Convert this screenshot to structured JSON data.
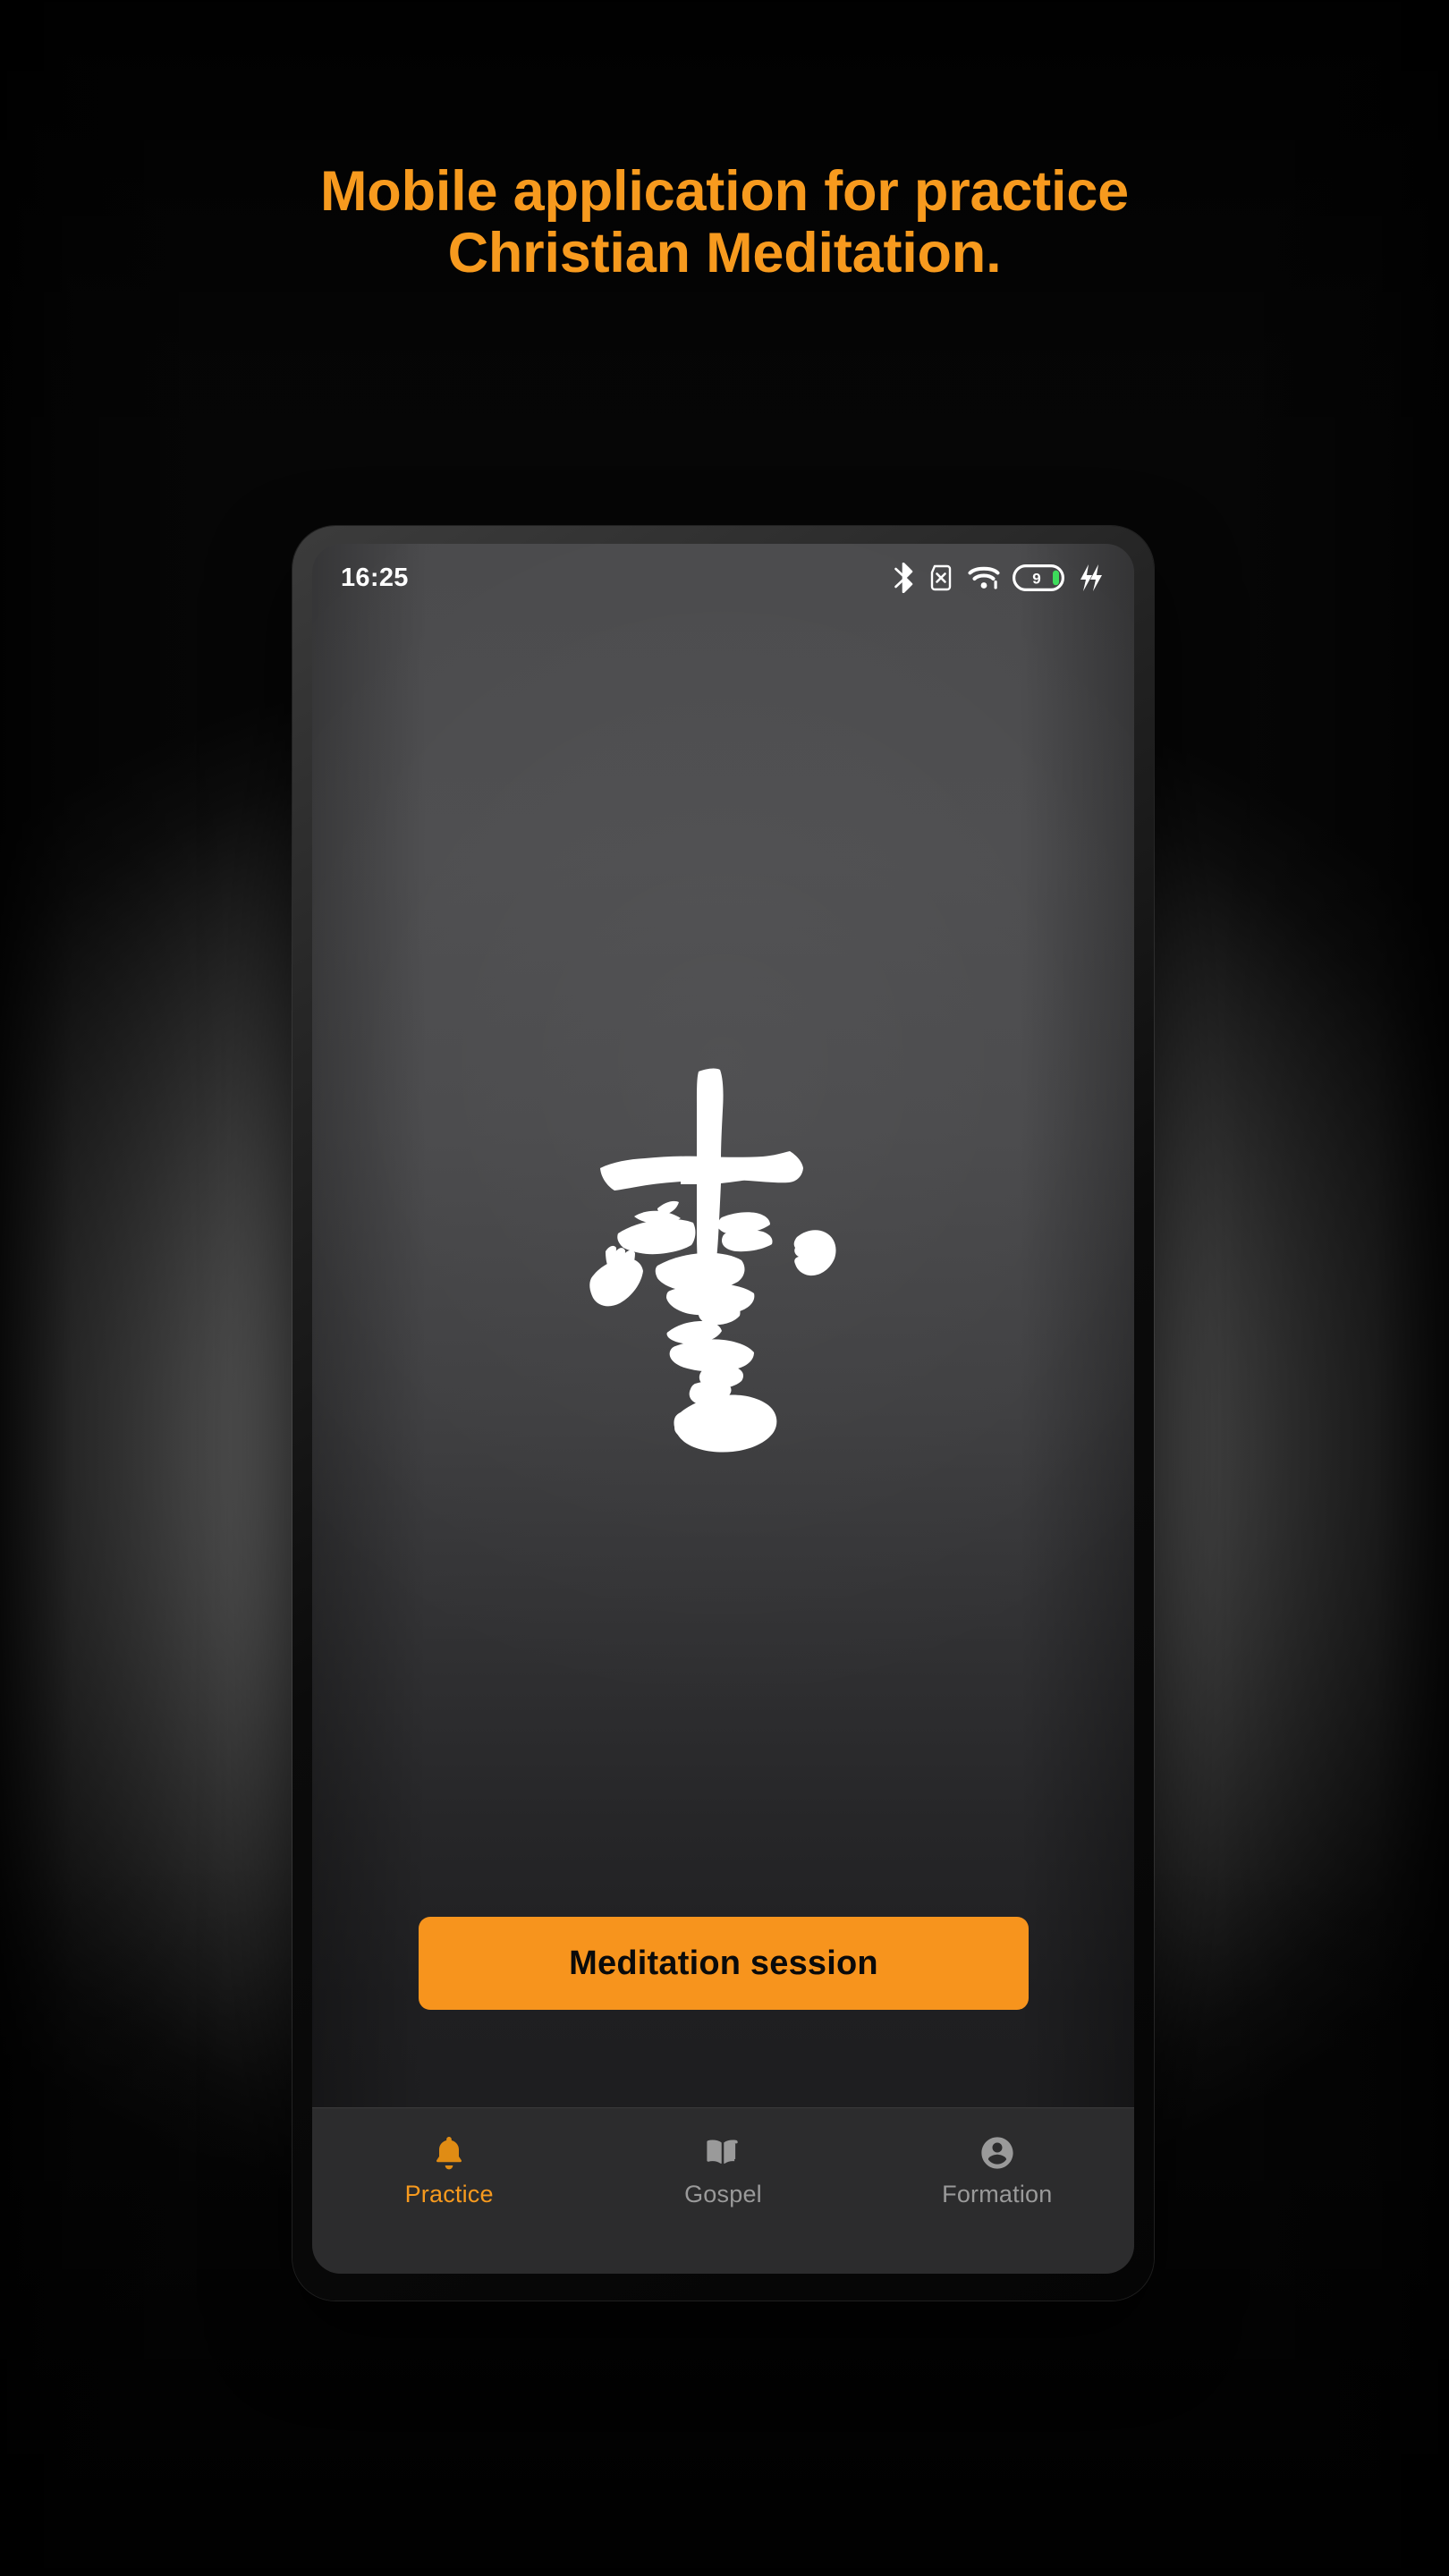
{
  "headline": {
    "text": "Mobile application for practice\nChristian Meditation.",
    "color": "#F79A1E"
  },
  "phone": {
    "statusbar": {
      "time": "16:25",
      "icons": [
        {
          "name": "bluetooth-icon",
          "label": "Bluetooth"
        },
        {
          "name": "sim-card-off-icon",
          "label": "No SIM"
        },
        {
          "name": "wifi-icon",
          "label": "Wi-Fi"
        },
        {
          "name": "battery-icon",
          "label": "Battery",
          "level_text": "9",
          "fill_color": "#3ddc5b"
        },
        {
          "name": "charging-bolt-icon",
          "label": "Charging"
        }
      ]
    },
    "logo": {
      "name": "calligraphy-cross-logo",
      "color": "#ffffff",
      "alt": "Brush-stroke Christian cross"
    },
    "cta": {
      "label": "Meditation session",
      "background": "#F7941D",
      "text_color": "#0a0a0a"
    },
    "bottom_nav": {
      "active_color": "#F79A1E",
      "inactive_color": "#9a9a9a",
      "items": [
        {
          "label": "Practice",
          "icon": "bell-icon",
          "active": true
        },
        {
          "label": "Gospel",
          "icon": "open-book-icon",
          "active": false
        },
        {
          "label": "Formation",
          "icon": "account-circle-icon",
          "active": false
        }
      ]
    }
  }
}
